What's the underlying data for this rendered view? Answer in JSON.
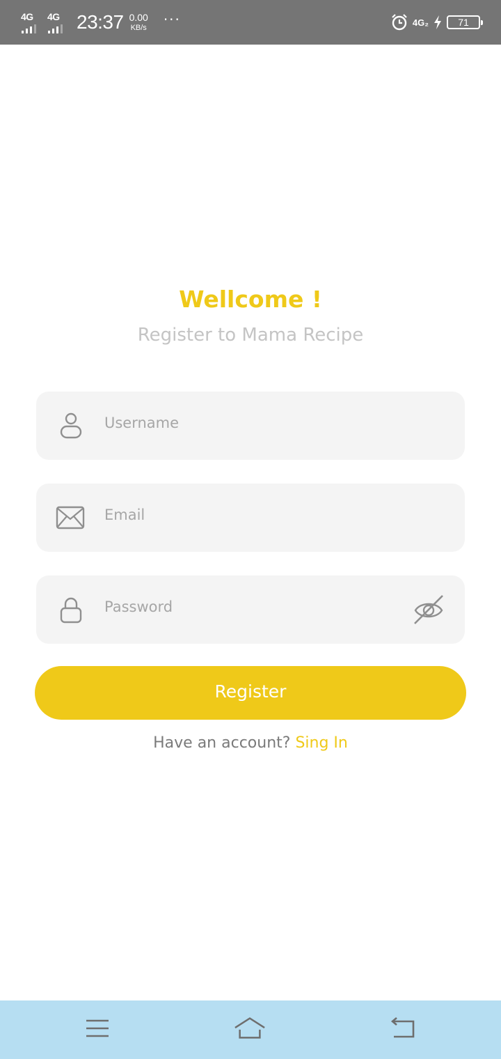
{
  "status_bar": {
    "signal_1_label": "4G",
    "signal_2_label": "4G",
    "time": "23:37",
    "speed_value": "0.00",
    "speed_unit": "KB/s",
    "more_dots": "···",
    "network_right": "4G₂",
    "battery_level": "71",
    "icons": [
      "signal-icon",
      "alarm-icon",
      "charging-icon",
      "battery-icon"
    ]
  },
  "header": {
    "title": "Wellcome !",
    "subtitle": "Register to Mama Recipe"
  },
  "form": {
    "username": {
      "placeholder": "Username",
      "value": "",
      "icon": "user-icon"
    },
    "email": {
      "placeholder": "Email",
      "value": "",
      "icon": "mail-icon"
    },
    "password": {
      "placeholder": "Password",
      "value": "",
      "icon": "lock-icon",
      "toggle_icon": "eye-off-icon"
    }
  },
  "register_button": {
    "label": "Register"
  },
  "signin": {
    "prompt": "Have an account?",
    "link": "Sing In"
  },
  "nav_bar": {
    "icons": [
      "menu-icon",
      "home-icon",
      "back-icon"
    ]
  },
  "colors": {
    "accent": "#efc919",
    "status_bar": "#757575",
    "field_bg": "#f4f4f4",
    "nav_bar": "#b6def2",
    "subtitle": "#c4c4c4",
    "placeholder": "#a6a6a6"
  }
}
